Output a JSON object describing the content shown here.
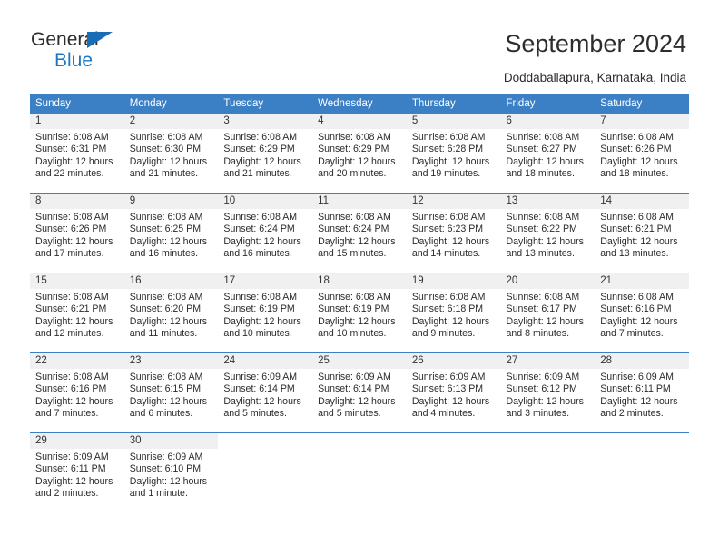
{
  "brand": {
    "line1": "General",
    "line2": "Blue",
    "triangle_color": "#1a6cb5",
    "text_color": "#2b2b2b",
    "blue_color": "#1f76c2"
  },
  "header": {
    "title": "September 2024",
    "subtitle": "Doddaballapura, Karnataka, India"
  },
  "theme": {
    "header_bg": "#3b7fc4",
    "header_text": "#ffffff",
    "daynum_bg": "#f0f0f0",
    "text": "#2b2b2b"
  },
  "weekdays": [
    "Sunday",
    "Monday",
    "Tuesday",
    "Wednesday",
    "Thursday",
    "Friday",
    "Saturday"
  ],
  "weeks": [
    [
      {
        "day": "1",
        "sunrise": "Sunrise: 6:08 AM",
        "sunset": "Sunset: 6:31 PM",
        "daylight": "Daylight: 12 hours and 22 minutes."
      },
      {
        "day": "2",
        "sunrise": "Sunrise: 6:08 AM",
        "sunset": "Sunset: 6:30 PM",
        "daylight": "Daylight: 12 hours and 21 minutes."
      },
      {
        "day": "3",
        "sunrise": "Sunrise: 6:08 AM",
        "sunset": "Sunset: 6:29 PM",
        "daylight": "Daylight: 12 hours and 21 minutes."
      },
      {
        "day": "4",
        "sunrise": "Sunrise: 6:08 AM",
        "sunset": "Sunset: 6:29 PM",
        "daylight": "Daylight: 12 hours and 20 minutes."
      },
      {
        "day": "5",
        "sunrise": "Sunrise: 6:08 AM",
        "sunset": "Sunset: 6:28 PM",
        "daylight": "Daylight: 12 hours and 19 minutes."
      },
      {
        "day": "6",
        "sunrise": "Sunrise: 6:08 AM",
        "sunset": "Sunset: 6:27 PM",
        "daylight": "Daylight: 12 hours and 18 minutes."
      },
      {
        "day": "7",
        "sunrise": "Sunrise: 6:08 AM",
        "sunset": "Sunset: 6:26 PM",
        "daylight": "Daylight: 12 hours and 18 minutes."
      }
    ],
    [
      {
        "day": "8",
        "sunrise": "Sunrise: 6:08 AM",
        "sunset": "Sunset: 6:26 PM",
        "daylight": "Daylight: 12 hours and 17 minutes."
      },
      {
        "day": "9",
        "sunrise": "Sunrise: 6:08 AM",
        "sunset": "Sunset: 6:25 PM",
        "daylight": "Daylight: 12 hours and 16 minutes."
      },
      {
        "day": "10",
        "sunrise": "Sunrise: 6:08 AM",
        "sunset": "Sunset: 6:24 PM",
        "daylight": "Daylight: 12 hours and 16 minutes."
      },
      {
        "day": "11",
        "sunrise": "Sunrise: 6:08 AM",
        "sunset": "Sunset: 6:24 PM",
        "daylight": "Daylight: 12 hours and 15 minutes."
      },
      {
        "day": "12",
        "sunrise": "Sunrise: 6:08 AM",
        "sunset": "Sunset: 6:23 PM",
        "daylight": "Daylight: 12 hours and 14 minutes."
      },
      {
        "day": "13",
        "sunrise": "Sunrise: 6:08 AM",
        "sunset": "Sunset: 6:22 PM",
        "daylight": "Daylight: 12 hours and 13 minutes."
      },
      {
        "day": "14",
        "sunrise": "Sunrise: 6:08 AM",
        "sunset": "Sunset: 6:21 PM",
        "daylight": "Daylight: 12 hours and 13 minutes."
      }
    ],
    [
      {
        "day": "15",
        "sunrise": "Sunrise: 6:08 AM",
        "sunset": "Sunset: 6:21 PM",
        "daylight": "Daylight: 12 hours and 12 minutes."
      },
      {
        "day": "16",
        "sunrise": "Sunrise: 6:08 AM",
        "sunset": "Sunset: 6:20 PM",
        "daylight": "Daylight: 12 hours and 11 minutes."
      },
      {
        "day": "17",
        "sunrise": "Sunrise: 6:08 AM",
        "sunset": "Sunset: 6:19 PM",
        "daylight": "Daylight: 12 hours and 10 minutes."
      },
      {
        "day": "18",
        "sunrise": "Sunrise: 6:08 AM",
        "sunset": "Sunset: 6:19 PM",
        "daylight": "Daylight: 12 hours and 10 minutes."
      },
      {
        "day": "19",
        "sunrise": "Sunrise: 6:08 AM",
        "sunset": "Sunset: 6:18 PM",
        "daylight": "Daylight: 12 hours and 9 minutes."
      },
      {
        "day": "20",
        "sunrise": "Sunrise: 6:08 AM",
        "sunset": "Sunset: 6:17 PM",
        "daylight": "Daylight: 12 hours and 8 minutes."
      },
      {
        "day": "21",
        "sunrise": "Sunrise: 6:08 AM",
        "sunset": "Sunset: 6:16 PM",
        "daylight": "Daylight: 12 hours and 7 minutes."
      }
    ],
    [
      {
        "day": "22",
        "sunrise": "Sunrise: 6:08 AM",
        "sunset": "Sunset: 6:16 PM",
        "daylight": "Daylight: 12 hours and 7 minutes."
      },
      {
        "day": "23",
        "sunrise": "Sunrise: 6:08 AM",
        "sunset": "Sunset: 6:15 PM",
        "daylight": "Daylight: 12 hours and 6 minutes."
      },
      {
        "day": "24",
        "sunrise": "Sunrise: 6:09 AM",
        "sunset": "Sunset: 6:14 PM",
        "daylight": "Daylight: 12 hours and 5 minutes."
      },
      {
        "day": "25",
        "sunrise": "Sunrise: 6:09 AM",
        "sunset": "Sunset: 6:14 PM",
        "daylight": "Daylight: 12 hours and 5 minutes."
      },
      {
        "day": "26",
        "sunrise": "Sunrise: 6:09 AM",
        "sunset": "Sunset: 6:13 PM",
        "daylight": "Daylight: 12 hours and 4 minutes."
      },
      {
        "day": "27",
        "sunrise": "Sunrise: 6:09 AM",
        "sunset": "Sunset: 6:12 PM",
        "daylight": "Daylight: 12 hours and 3 minutes."
      },
      {
        "day": "28",
        "sunrise": "Sunrise: 6:09 AM",
        "sunset": "Sunset: 6:11 PM",
        "daylight": "Daylight: 12 hours and 2 minutes."
      }
    ],
    [
      {
        "day": "29",
        "sunrise": "Sunrise: 6:09 AM",
        "sunset": "Sunset: 6:11 PM",
        "daylight": "Daylight: 12 hours and 2 minutes."
      },
      {
        "day": "30",
        "sunrise": "Sunrise: 6:09 AM",
        "sunset": "Sunset: 6:10 PM",
        "daylight": "Daylight: 12 hours and 1 minute."
      },
      {
        "day": "",
        "sunrise": "",
        "sunset": "",
        "daylight": ""
      },
      {
        "day": "",
        "sunrise": "",
        "sunset": "",
        "daylight": ""
      },
      {
        "day": "",
        "sunrise": "",
        "sunset": "",
        "daylight": ""
      },
      {
        "day": "",
        "sunrise": "",
        "sunset": "",
        "daylight": ""
      },
      {
        "day": "",
        "sunrise": "",
        "sunset": "",
        "daylight": ""
      }
    ]
  ]
}
